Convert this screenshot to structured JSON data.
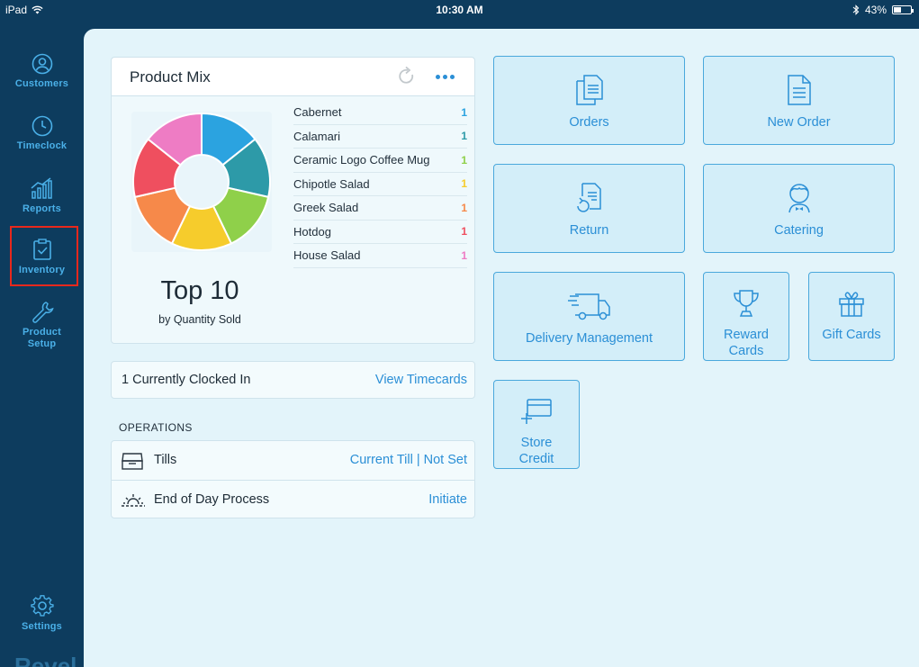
{
  "status_bar": {
    "device": "iPad",
    "time": "10:30 AM",
    "battery": "43%",
    "battery_level": 0.43
  },
  "sidebar": {
    "items": [
      {
        "label": "Customers",
        "icon": "user-circle-icon"
      },
      {
        "label": "Timeclock",
        "icon": "clock-icon"
      },
      {
        "label": "Reports",
        "icon": "bar-chart-icon"
      },
      {
        "label": "Inventory",
        "icon": "clipboard-check-icon",
        "highlighted": true
      },
      {
        "label": "Product Setup",
        "icon": "wrench-icon"
      }
    ],
    "settings": {
      "label": "Settings",
      "icon": "gear-icon"
    },
    "brand": "Revel"
  },
  "product_mix": {
    "title": "Product Mix",
    "headline": "Top 10",
    "subheadline": "by Quantity Sold",
    "items": [
      {
        "name": "Cabernet",
        "value": "1",
        "color": "#2ba3e0"
      },
      {
        "name": "Calamari",
        "value": "1",
        "color": "#2d9aa8"
      },
      {
        "name": "Ceramic Logo Coffee Mug",
        "value": "1",
        "color": "#8fd04a"
      },
      {
        "name": "Chipotle Salad",
        "value": "1",
        "color": "#f6cc2c"
      },
      {
        "name": "Greek Salad",
        "value": "1",
        "color": "#f6894a"
      },
      {
        "name": "Hotdog",
        "value": "1",
        "color": "#ef4f5f"
      },
      {
        "name": "House Salad",
        "value": "1",
        "color": "#ee7cc4"
      }
    ]
  },
  "clock_in": {
    "text": "1 Currently Clocked In",
    "link": "View Timecards"
  },
  "operations": {
    "label": "OPERATIONS",
    "rows": [
      {
        "label": "Tills",
        "action": "Current Till | Not Set",
        "icon": "till-drawer-icon"
      },
      {
        "label": "End of Day Process",
        "action": "Initiate",
        "icon": "sunset-icon"
      }
    ]
  },
  "tiles": {
    "orders": "Orders",
    "new_order": "New Order",
    "return": "Return",
    "catering": "Catering",
    "delivery": "Delivery Management",
    "reward_1": "Reward",
    "reward_2": "Cards",
    "gift": "Gift Cards",
    "store_1": "Store",
    "store_2": "Credit"
  },
  "colors": {
    "sidebar_bg": "#0d3c5e",
    "accent": "#2b8fd6",
    "main_bg": "#e3f4fa",
    "highlight": "#e8281c"
  }
}
